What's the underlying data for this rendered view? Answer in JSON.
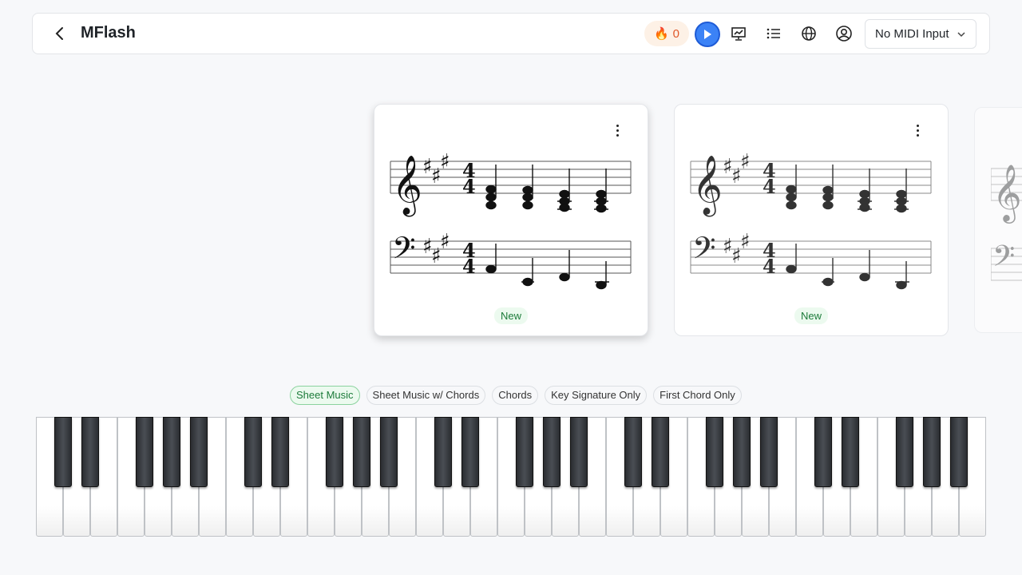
{
  "header": {
    "title": "MFlash",
    "streak_count": "0",
    "midi_select_value": "No MIDI Input"
  },
  "cards": [
    {
      "badge": "New"
    },
    {
      "badge": "New"
    }
  ],
  "chips": [
    "Sheet Music",
    "Sheet Music w/ Chords",
    "Chords",
    "Key Signature Only",
    "First Chord Only"
  ],
  "active_chip": "Sheet Music",
  "colors": {
    "accent_blue": "#3b82f6",
    "new_green": "#1c7b3a",
    "streak_orange": "#e0582a"
  }
}
